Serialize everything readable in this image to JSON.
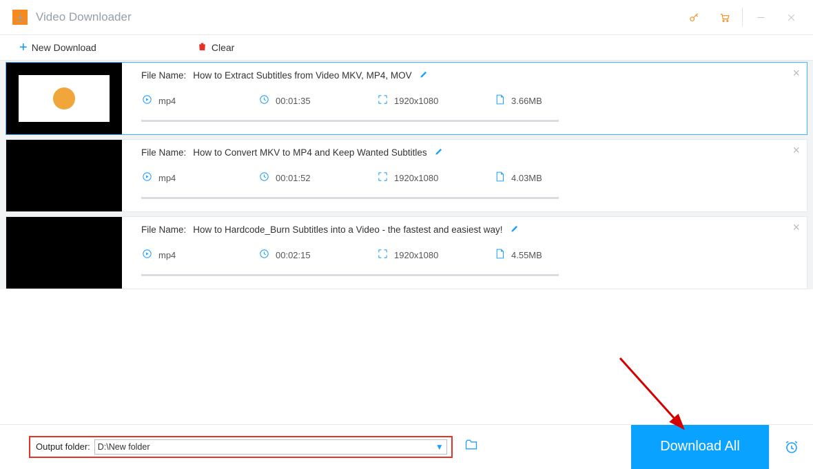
{
  "app": {
    "title": "Video Downloader"
  },
  "toolbar": {
    "new_download": "New Download",
    "clear": "Clear"
  },
  "labels": {
    "file_name_prefix": "File Name:"
  },
  "items": [
    {
      "selected": true,
      "white_thumb": true,
      "name": "How to Extract Subtitles from Video MKV, MP4, MOV",
      "format": "mp4",
      "duration": "00:01:35",
      "resolution": "1920x1080",
      "size": "3.66MB"
    },
    {
      "selected": false,
      "white_thumb": false,
      "name": "How to Convert MKV to MP4 and Keep Wanted Subtitles",
      "format": "mp4",
      "duration": "00:01:52",
      "resolution": "1920x1080",
      "size": "4.03MB"
    },
    {
      "selected": false,
      "white_thumb": false,
      "name": "How to Hardcode_Burn Subtitles into a Video - the fastest and easiest way!",
      "format": "mp4",
      "duration": "00:02:15",
      "resolution": "1920x1080",
      "size": "4.55MB"
    }
  ],
  "footer": {
    "output_folder_label": "Output folder:",
    "output_folder_value": "D:\\New folder",
    "download_all": "Download All"
  }
}
